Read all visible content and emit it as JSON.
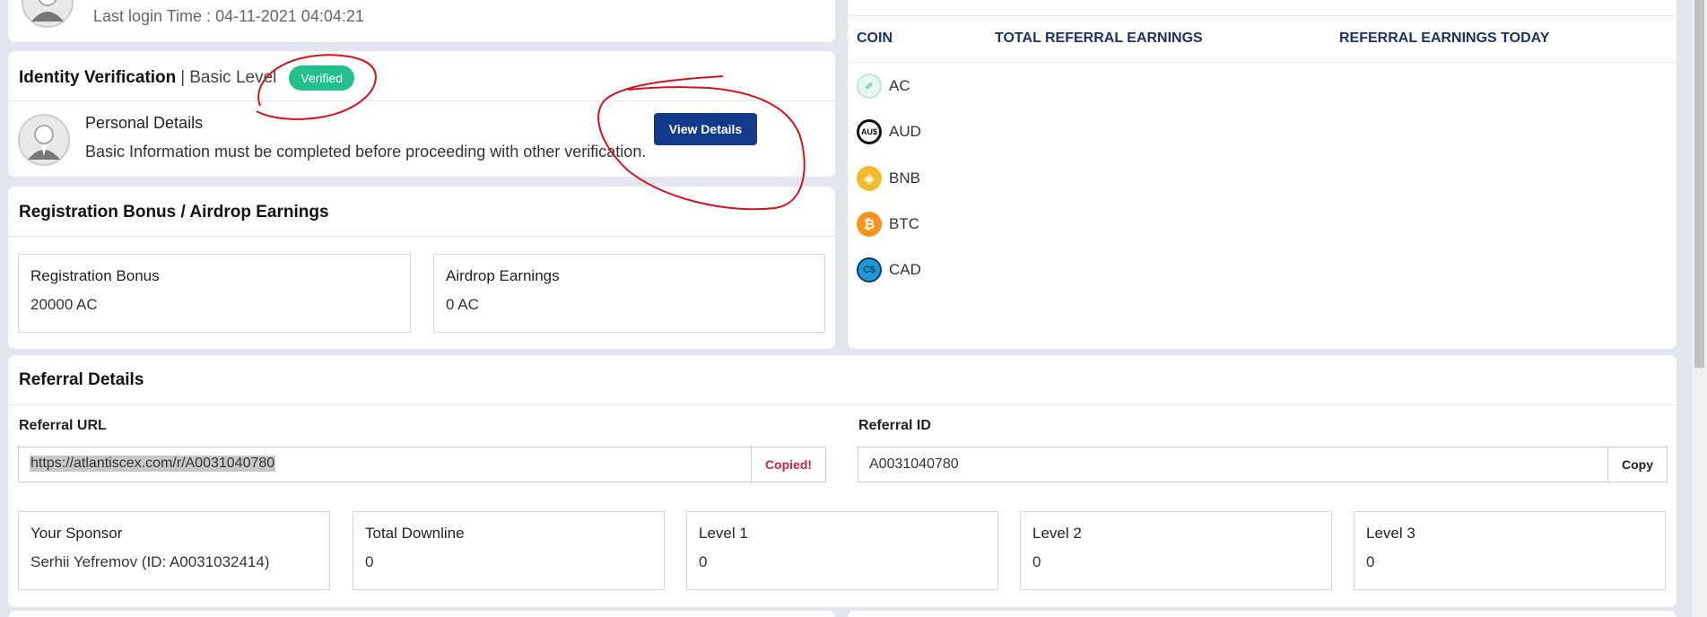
{
  "profile": {
    "last_login": "Last login Time : 04-11-2021 04:04:21"
  },
  "identity": {
    "title": "Identity Verification",
    "separator": "|",
    "level": "Basic Level",
    "badge": "Verified",
    "personal_title": "Personal Details",
    "personal_text": "Basic Information must be completed before proceeding with other verification.",
    "view_button": "View Details"
  },
  "registration": {
    "title": "Registration Bonus / Airdrop Earnings",
    "boxes": [
      {
        "label": "Registration Bonus",
        "value": "20000 AC"
      },
      {
        "label": "Airdrop Earnings",
        "value": "0 AC"
      }
    ]
  },
  "coins_table": {
    "headers": [
      "COIN",
      "TOTAL REFERRAL EARNINGS",
      "REFERRAL EARNINGS TODAY"
    ],
    "rows": [
      {
        "coin": "AC",
        "icon": "ac-coin-icon",
        "glyph": "✐",
        "color": "#2bb673"
      },
      {
        "coin": "AUD",
        "icon": "aud-coin-icon",
        "glyph": "AU$",
        "color": "#111111"
      },
      {
        "coin": "BNB",
        "icon": "bnb-coin-icon",
        "glyph": "◈",
        "color": "#f3ba2f"
      },
      {
        "coin": "BTC",
        "icon": "btc-coin-icon",
        "glyph": "₿",
        "color": "#f7931a"
      },
      {
        "coin": "CAD",
        "icon": "cad-coin-icon",
        "glyph": "C$",
        "color": "#1b9ad6"
      }
    ]
  },
  "referral": {
    "title": "Referral Details",
    "url_label": "Referral URL",
    "url_value": "https://atlantiscex.com/r/A0031040780",
    "url_button": "Copied!",
    "id_label": "Referral ID",
    "id_value": "A0031040780",
    "id_button": "Copy",
    "copied_color": "#c0283c",
    "stats": [
      {
        "label": "Your Sponsor",
        "value": "Serhii Yefremov (ID: A0031032414)"
      },
      {
        "label": "Total Downline",
        "value": "0"
      },
      {
        "label": "Level 1",
        "value": "0"
      },
      {
        "label": "Level 2",
        "value": "0"
      },
      {
        "label": "Level 3",
        "value": "0"
      }
    ]
  },
  "colors": {
    "accent": "#123a8a",
    "verified": "#22c08a",
    "header_text": "#1d3461",
    "annotation": "#d0141e"
  }
}
